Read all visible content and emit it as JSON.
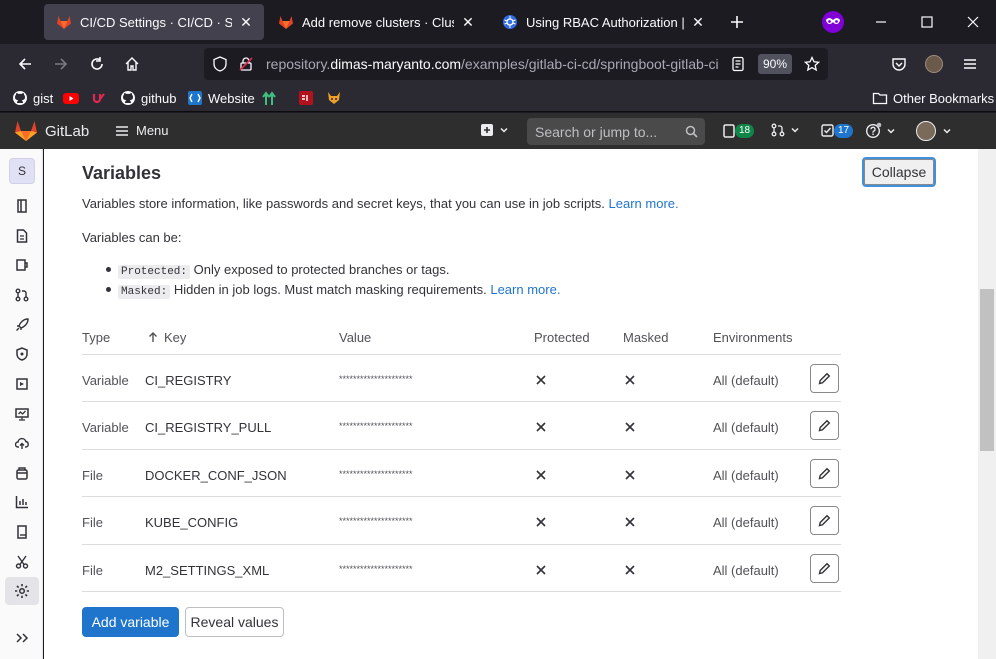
{
  "browser": {
    "tabs": [
      {
        "title": "CI/CD Settings · CI/CD · Settings",
        "active": true
      },
      {
        "title": "Add remove clusters · Clusters",
        "active": false
      },
      {
        "title": "Using RBAC Authorization | Kube",
        "active": false
      }
    ],
    "url_prefix": "repository.",
    "url_domain": "dimas-maryanto.com",
    "url_path": "/examples/gitlab-ci-cd/springboot-gitlab-ci",
    "zoom": "90%",
    "bookmarks": [
      "gist",
      "github",
      "Website"
    ],
    "other_bookmarks": "Other Bookmarks"
  },
  "gitlab_header": {
    "brand": "GitLab",
    "menu_label": "Menu",
    "search_placeholder": "Search or jump to...",
    "issues_count": "18",
    "todos_count": "17"
  },
  "sidebar": {
    "project_avatar": "S"
  },
  "section": {
    "title": "Variables",
    "collapse_label": "Collapse",
    "description": "Variables store information, like passwords and secret keys, that you can use in job scripts.",
    "learn_more": "Learn more.",
    "can_be": "Variables can be:",
    "bullets": [
      {
        "code": "Protected:",
        "text": "Only exposed to protected branches or tags.",
        "link": ""
      },
      {
        "code": "Masked:",
        "text": "Hidden in job logs. Must match masking requirements.",
        "link": "Learn more."
      }
    ]
  },
  "table": {
    "headers": {
      "type": "Type",
      "key": "Key",
      "value": "Value",
      "protected": "Protected",
      "masked": "Masked",
      "environments": "Environments"
    },
    "rows": [
      {
        "type": "Variable",
        "key": "CI_REGISTRY",
        "value": "*********************",
        "env": "All (default)"
      },
      {
        "type": "Variable",
        "key": "CI_REGISTRY_PULL",
        "value": "*********************",
        "env": "All (default)"
      },
      {
        "type": "File",
        "key": "DOCKER_CONF_JSON",
        "value": "*********************",
        "env": "All (default)"
      },
      {
        "type": "File",
        "key": "KUBE_CONFIG",
        "value": "*********************",
        "env": "All (default)"
      },
      {
        "type": "File",
        "key": "M2_SETTINGS_XML",
        "value": "*********************",
        "env": "All (default)"
      }
    ]
  },
  "actions": {
    "add_variable": "Add variable",
    "reveal_values": "Reveal values"
  }
}
